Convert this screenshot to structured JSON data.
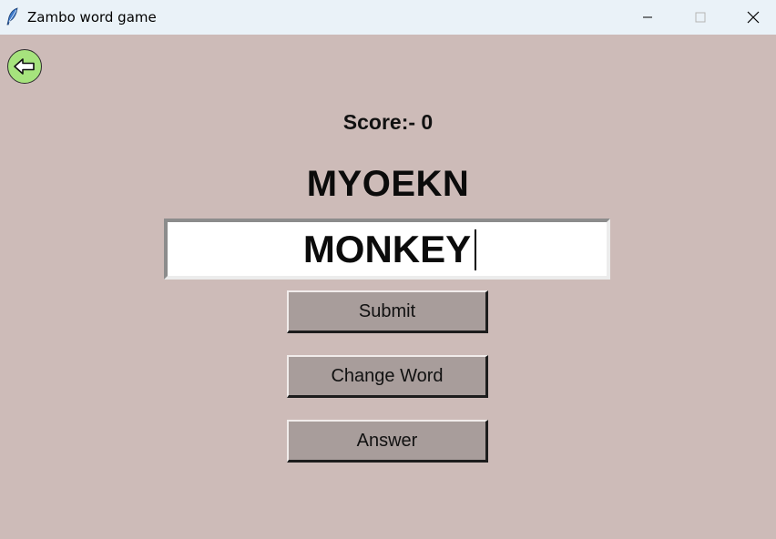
{
  "window": {
    "title": "Zambo word game",
    "icons": {
      "app": "feather-icon",
      "minimize": "minimize-icon",
      "maximize": "maximize-icon",
      "close": "close-icon"
    }
  },
  "colors": {
    "background": "#cdbbb8",
    "titlebar": "#eaf2f8",
    "back_button": "#a6e37d",
    "button_face": "#a89d9b"
  },
  "game": {
    "back_icon": "arrow-left-icon",
    "score_text": "Score:- 0",
    "scrambled_word": "MYOEKN",
    "answer_input_value": "MONKEY",
    "buttons": {
      "submit": "Submit",
      "change_word": "Change Word",
      "answer": "Answer"
    }
  }
}
